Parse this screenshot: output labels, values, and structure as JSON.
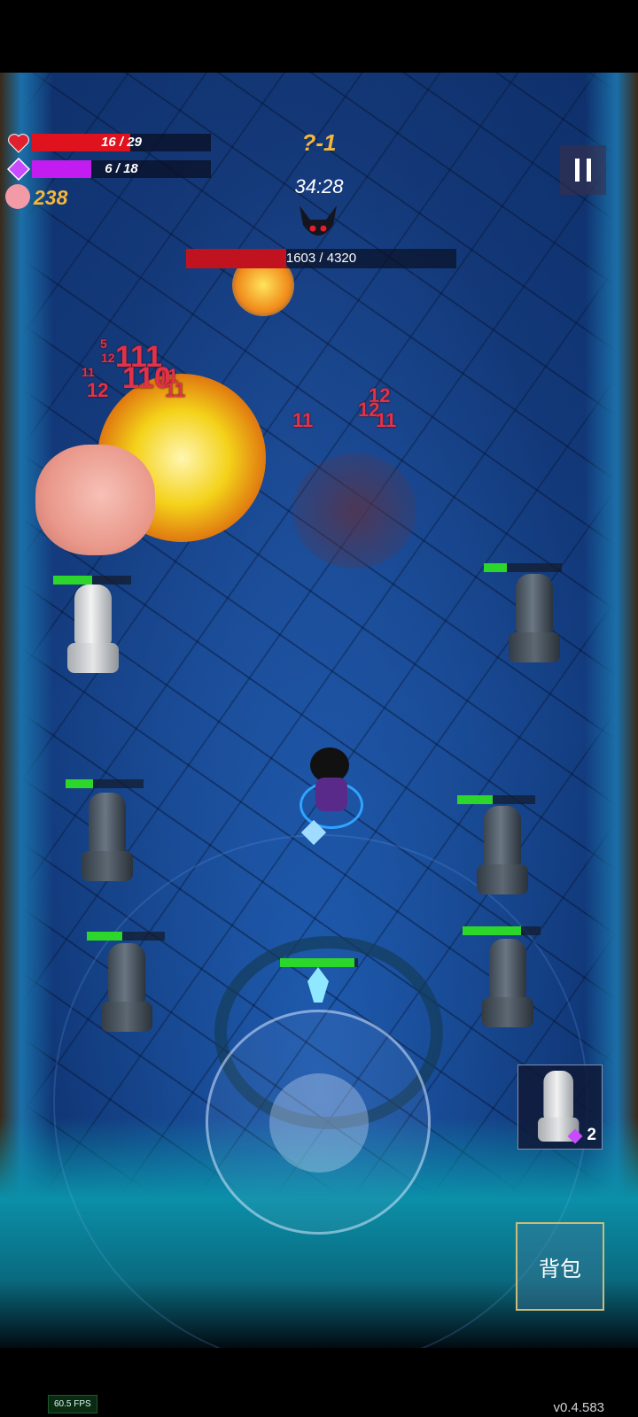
{
  "hud": {
    "health": {
      "text": "16 / 29",
      "current": 16,
      "max": 29,
      "color": "#e0121e",
      "icon": "heart-icon"
    },
    "mana": {
      "text": "6 / 18",
      "current": 6,
      "max": 18,
      "color": "#c21cf0",
      "icon": "mana-gem-icon"
    },
    "coins": {
      "value": "238",
      "icon": "pig-coin-icon"
    },
    "stage": "?-1",
    "timer": "34:28",
    "pause_icon": "pause-icon"
  },
  "boss": {
    "hp_text": "1603 / 4320",
    "current": 1603,
    "max": 4320,
    "icon": "demon-boss-icon"
  },
  "damage_numbers": [
    "5",
    "12",
    "11",
    "111",
    "12",
    "11",
    "110",
    "11",
    "11",
    "12",
    "12",
    "11"
  ],
  "statues": [
    {
      "hp": 0.5,
      "lit": true
    },
    {
      "hp": 0.35
    },
    {
      "hp": 0.45
    },
    {
      "hp": 0.3
    },
    {
      "hp": 0.45
    },
    {
      "hp": 0.75
    },
    {
      "hp": 0.95
    }
  ],
  "inventory": {
    "count": "2",
    "item_icon": "moai-statue-icon"
  },
  "bag_button": "背包",
  "fps": "60.5 FPS",
  "version": "v0.4.583"
}
